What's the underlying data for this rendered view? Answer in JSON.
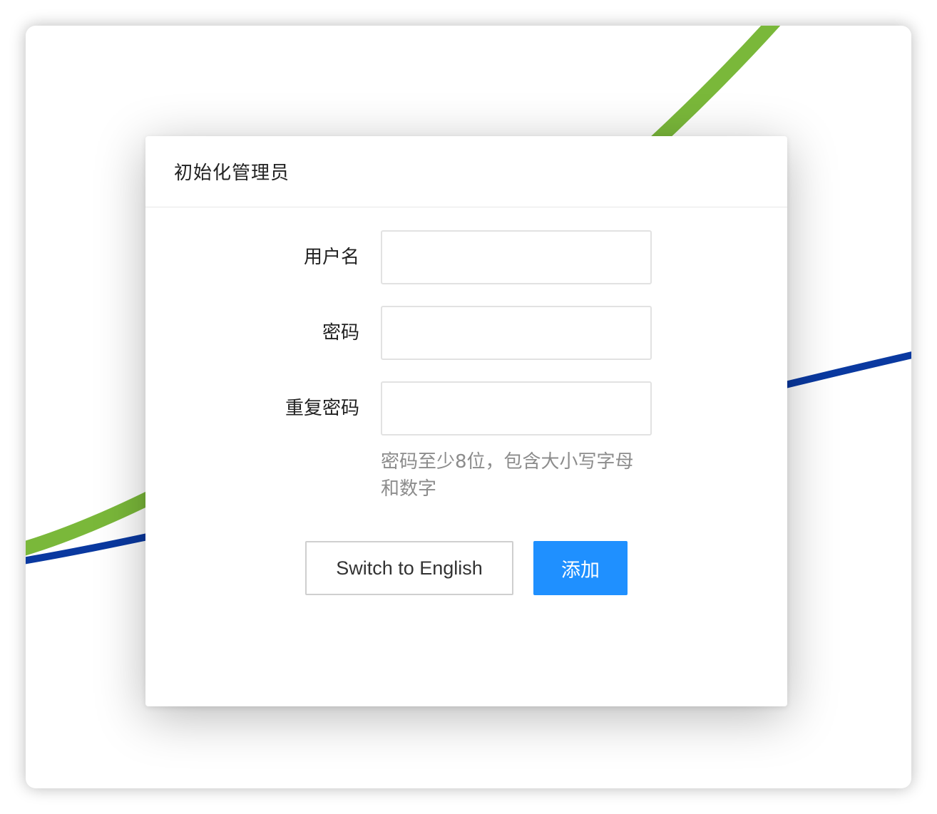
{
  "dialog": {
    "title": "初始化管理员"
  },
  "form": {
    "username_label": "用户名",
    "username_value": "",
    "password_label": "密码",
    "password_value": "",
    "repeat_password_label": "重复密码",
    "repeat_password_value": "",
    "password_hint": "密码至少8位，包含大小写字母和数字"
  },
  "buttons": {
    "switch_language_label": "Switch to English",
    "add_label": "添加"
  },
  "colors": {
    "primary": "#1f90ff",
    "line_green": "#7ab83a",
    "line_blue": "#0a39a0"
  }
}
